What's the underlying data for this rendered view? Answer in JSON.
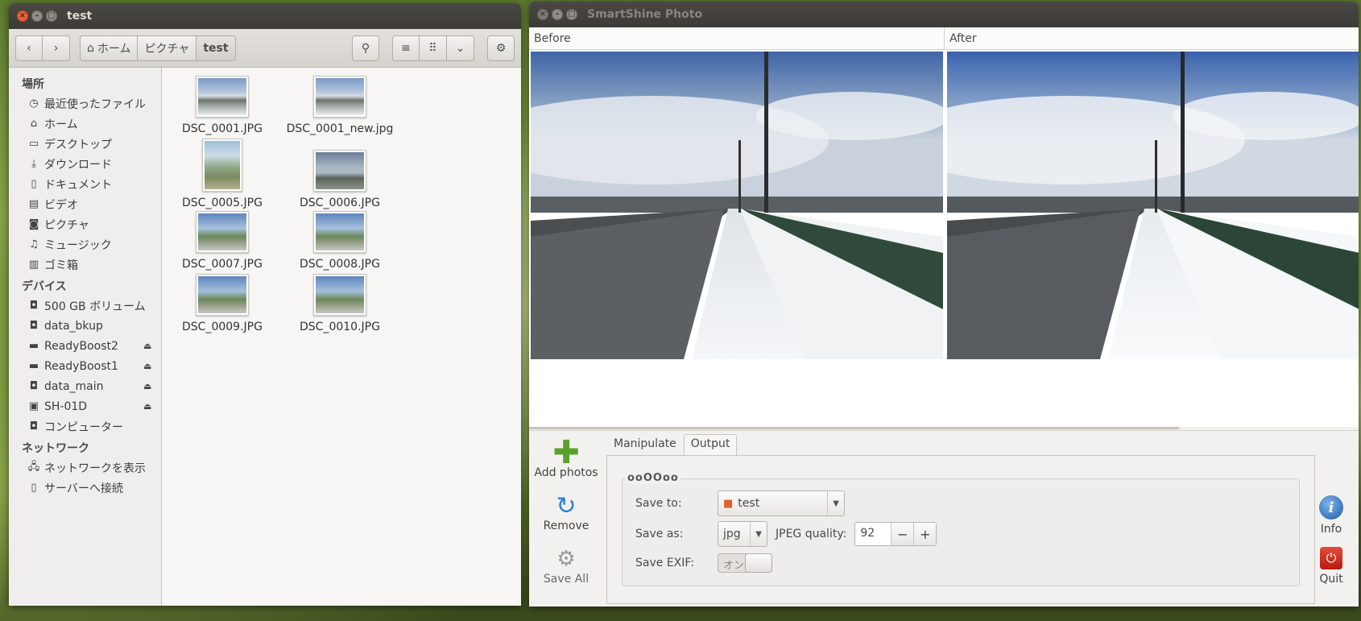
{
  "file_manager": {
    "window_title": "test",
    "path": [
      "ホーム",
      "ピクチャ",
      "test"
    ],
    "sidebar": {
      "places_header": "場所",
      "places": [
        {
          "label": "最近使ったファイル",
          "icon": "clock-icon"
        },
        {
          "label": "ホーム",
          "icon": "home-icon"
        },
        {
          "label": "デスクトップ",
          "icon": "folder-icon"
        },
        {
          "label": "ダウンロード",
          "icon": "download-icon"
        },
        {
          "label": "ドキュメント",
          "icon": "document-icon"
        },
        {
          "label": "ビデオ",
          "icon": "film-icon"
        },
        {
          "label": "ピクチャ",
          "icon": "camera-icon"
        },
        {
          "label": "ミュージック",
          "icon": "music-icon"
        },
        {
          "label": "ゴミ箱",
          "icon": "trash-icon"
        }
      ],
      "devices_header": "デバイス",
      "devices": [
        {
          "label": "500 GB ボリューム",
          "eject": false
        },
        {
          "label": "data_bkup",
          "eject": false
        },
        {
          "label": "ReadyBoost2",
          "eject": true
        },
        {
          "label": "ReadyBoost1",
          "eject": true
        },
        {
          "label": "data_main",
          "eject": true
        },
        {
          "label": "SH-01D",
          "eject": true
        },
        {
          "label": "コンピューター",
          "eject": false
        }
      ],
      "network_header": "ネットワーク",
      "network": [
        {
          "label": "ネットワークを表示"
        },
        {
          "label": "サーバーへ接続"
        }
      ]
    },
    "files": [
      "DSC_0001.JPG",
      "DSC_0001_new.jpg",
      "DSC_0005.JPG",
      "DSC_0006.JPG",
      "DSC_0007.JPG",
      "DSC_0008.JPG",
      "DSC_0009.JPG",
      "DSC_0010.JPG"
    ]
  },
  "smartshine": {
    "window_title": "SmartShine Photo",
    "before_label": "Before",
    "after_label": "After",
    "actions": {
      "add": "Add photos",
      "remove": "Remove",
      "save_all": "Save All",
      "info": "Info",
      "quit": "Quit"
    },
    "tabs": [
      "Manipulate",
      "Output"
    ],
    "active_tab": "Output",
    "output": {
      "frame_title": "ooOOoo",
      "save_to_label": "Save to:",
      "save_to_value": "test",
      "save_as_label": "Save as:",
      "save_as_value": "jpg",
      "jpeg_quality_label": "JPEG quality:",
      "jpeg_quality_value": "92",
      "save_exif_label": "Save EXIF:",
      "save_exif_state": "オン"
    }
  }
}
